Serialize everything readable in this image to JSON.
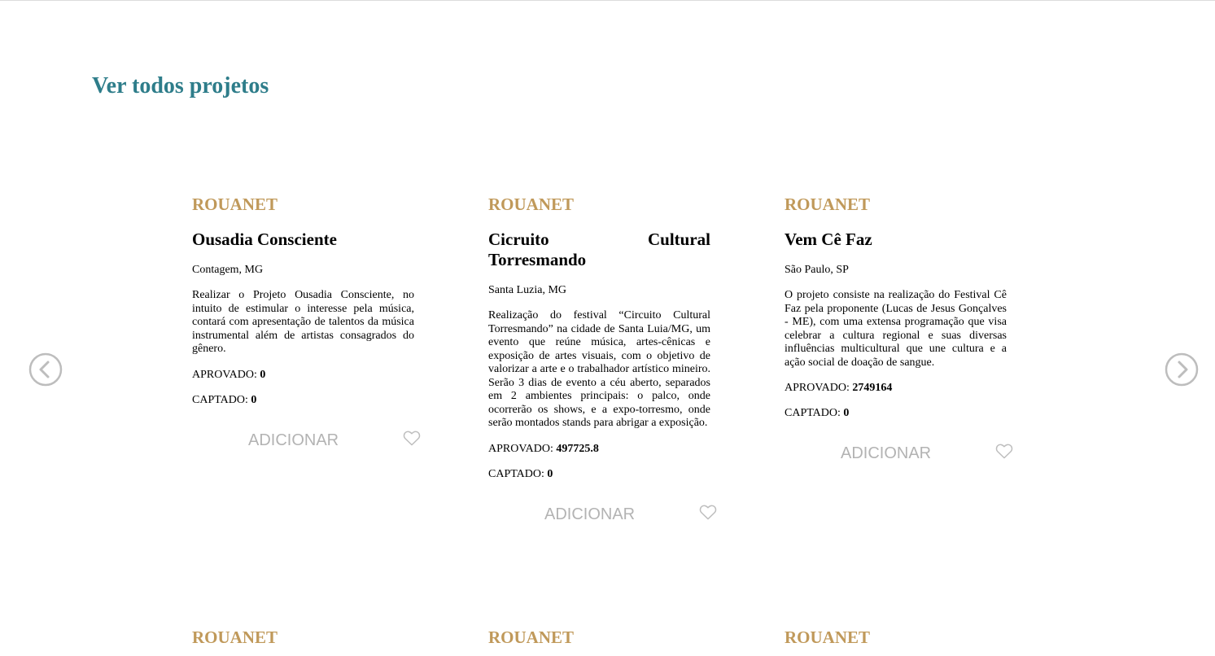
{
  "page": {
    "title": "Ver todos projetos"
  },
  "colors": {
    "title": "#2e7d8a",
    "category": "#c0995a",
    "muted": "#b3b3b3"
  },
  "carousel": {
    "prev_icon": "chevron-left-circle-icon",
    "next_icon": "chevron-right-circle-icon",
    "cards": [
      {
        "category": "ROUANET",
        "title": "Ousadia Consciente",
        "location": "Contagem, MG",
        "description": "Realizar o Projeto Ousadia Consciente, no intuito de estimular o interesse pela música, contará com apresentação de talentos da música instrumental além de artistas consagrados do gênero.",
        "approved_label": "APROVADO:",
        "approved_value": "0",
        "raised_label": "CAPTADO:",
        "raised_value": "0",
        "add_label": "ADICIONAR",
        "heart_icon": "heart-outline-icon"
      },
      {
        "category": "ROUANET",
        "title": "Cicruito Cultural Torresmando",
        "location": "Santa Luzia, MG",
        "description": "Realização do festival “Circuito Cultural Torresmando” na cidade de Santa Luia/MG, um evento que reúne música, artes-cênicas e exposição de artes visuais, com o objetivo de valorizar a arte e o trabalhador artístico mineiro. Serão 3 dias de evento a céu aberto, separados em 2 ambientes principais: o palco, onde ocorrerão os shows, e a expo-torresmo, onde serão montados stands para abrigar a exposição.",
        "approved_label": "APROVADO:",
        "approved_value": "497725.8",
        "raised_label": "CAPTADO:",
        "raised_value": "0",
        "add_label": "ADICIONAR",
        "heart_icon": "heart-outline-icon"
      },
      {
        "category": "ROUANET",
        "title": "Vem Cê Faz",
        "location": "São Paulo, SP",
        "description": "O projeto consiste na realização do Festival Cê Faz pela proponente (Lucas de Jesus Gonçalves - ME), com uma extensa programação que visa celebrar a cultura regional e suas diversas influências multicultural que une cultura e a ação social de doação de sangue.",
        "approved_label": "APROVADO:",
        "approved_value": "2749164",
        "raised_label": "CAPTADO:",
        "raised_value": "0",
        "add_label": "ADICIONAR",
        "heart_icon": "heart-outline-icon"
      }
    ],
    "next_row_categories": [
      "ROUANET",
      "ROUANET",
      "ROUANET"
    ]
  }
}
